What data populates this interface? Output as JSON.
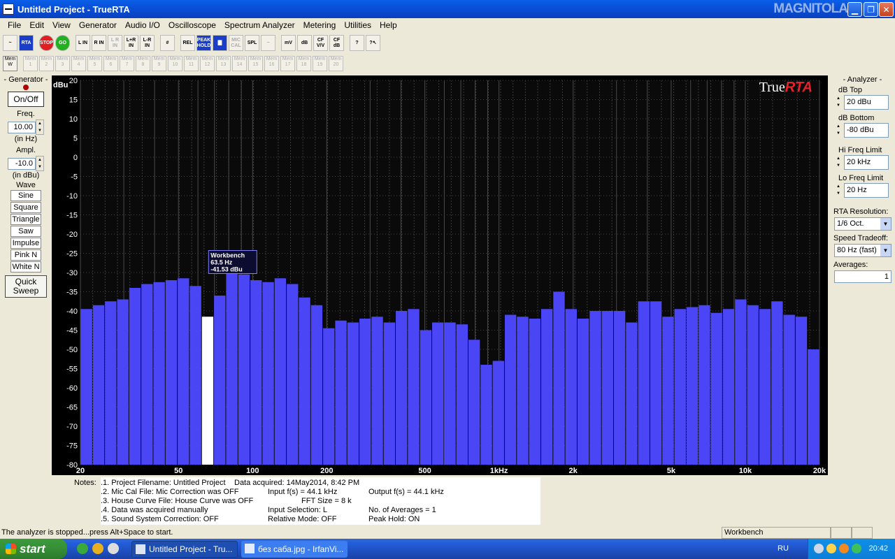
{
  "window": {
    "title": "Untitled Project - TrueRTA",
    "watermark": "MAGNITOLA"
  },
  "menu": [
    "File",
    "Edit",
    "View",
    "Generator",
    "Audio I/O",
    "Oscilloscope",
    "Spectrum Analyzer",
    "Metering",
    "Utilities",
    "Help"
  ],
  "toolbar": {
    "buttons": [
      {
        "name": "oscilloscope-view",
        "label": "~"
      },
      {
        "name": "spectrum-view",
        "label": "RTA"
      },
      {
        "name": "stop",
        "label": "STOP"
      },
      {
        "name": "go",
        "label": "GO"
      },
      {
        "name": "l-in",
        "label": "L IN"
      },
      {
        "name": "r-in",
        "label": "R IN"
      },
      {
        "name": "l-r-in-gray",
        "label": "L R IN"
      },
      {
        "name": "l-plus-r-in",
        "label": "L+R IN"
      },
      {
        "name": "l-minus-r-in",
        "label": "L-R IN"
      },
      {
        "name": "grid",
        "label": "#"
      },
      {
        "name": "rel",
        "label": "REL"
      },
      {
        "name": "peak-hold",
        "label": "PEAK HOLD"
      },
      {
        "name": "bars",
        "label": "▇"
      },
      {
        "name": "mic-cal",
        "label": "MIC CAL"
      },
      {
        "name": "spl",
        "label": "SPL"
      },
      {
        "name": "smooth",
        "label": "~"
      },
      {
        "name": "mv",
        "label": "mV"
      },
      {
        "name": "db",
        "label": "dB"
      },
      {
        "name": "cf-vv",
        "label": "CF V/V"
      },
      {
        "name": "cf-db",
        "label": "CF dB"
      },
      {
        "name": "help",
        "label": "?"
      },
      {
        "name": "context-help",
        "label": "?↖"
      }
    ],
    "mem_buttons": [
      "Mem W",
      "Mem 1",
      "Mem 2",
      "Mem 3",
      "Mem 4",
      "Mem 5",
      "Mem 6",
      "Mem 7",
      "Mem 8",
      "Mem 9",
      "Mem 10",
      "Mem 11",
      "Mem 12",
      "Mem 13",
      "Mem 14",
      "Mem 15",
      "Mem 16",
      "Mem 17",
      "Mem 18",
      "Mem 19",
      "Mem 20"
    ]
  },
  "generator": {
    "title": "- Generator -",
    "onoff_label": "On/Off",
    "freq_label": "Freq.",
    "freq_value": "10.00",
    "freq_unit": "(in Hz)",
    "ampl_label": "Ampl.",
    "ampl_value": "-10.0",
    "ampl_unit": "(in dBu)",
    "wave_label": "Wave",
    "waves": [
      "Sine",
      "Square",
      "Triangle",
      "Saw",
      "Impulse",
      "Pink N",
      "White N"
    ],
    "quick_sweep_label": "Quick Sweep"
  },
  "analyzer": {
    "title": "- Analyzer -",
    "db_top_label": "dB Top",
    "db_top_value": "20 dBu",
    "db_bottom_label": "dB Bottom",
    "db_bottom_value": "-80 dBu",
    "hi_freq_label": "Hi Freq Limit",
    "hi_freq_value": "20 kHz",
    "lo_freq_label": "Lo Freq Limit",
    "lo_freq_value": "20 Hz",
    "rta_res_label": "RTA Resolution:",
    "rta_res_value": "1/6 Oct.",
    "speed_label": "Speed Tradeoff:",
    "speed_value": "80 Hz (fast)",
    "averages_label": "Averages:",
    "averages_value": "1"
  },
  "chart_data": {
    "type": "bar",
    "logo": {
      "a": "True",
      "b": "RTA"
    },
    "ylabel": "dBu",
    "ylim": [
      -80,
      20
    ],
    "yticks": [
      20,
      15,
      10,
      5,
      0,
      -5,
      -10,
      -15,
      -20,
      -25,
      -30,
      -35,
      -40,
      -45,
      -50,
      -55,
      -60,
      -65,
      -70,
      -75,
      -80
    ],
    "xlim": [
      20,
      20000
    ],
    "xscale": "log",
    "xticks": [
      {
        "v": 20,
        "label": "20"
      },
      {
        "v": 50,
        "label": "50"
      },
      {
        "v": 100,
        "label": "100"
      },
      {
        "v": 200,
        "label": "200"
      },
      {
        "v": 500,
        "label": "500"
      },
      {
        "v": 1000,
        "label": "1kHz"
      },
      {
        "v": 2000,
        "label": "2k"
      },
      {
        "v": 5000,
        "label": "5k"
      },
      {
        "v": 10000,
        "label": "10k"
      },
      {
        "v": 20000,
        "label": "20k"
      }
    ],
    "bar_color": "#4a46f5",
    "highlight_color": "#ffffff",
    "values": [
      -39.5,
      -38.5,
      -37.5,
      -37.0,
      -34.0,
      -33.0,
      -32.5,
      -32.0,
      -31.5,
      -33.5,
      -41.5,
      -36.0,
      -29.5,
      -30.5,
      -32.0,
      -32.5,
      -31.5,
      -33.0,
      -36.5,
      -38.5,
      -44.5,
      -42.5,
      -43.0,
      -42.0,
      -41.5,
      -43.0,
      -40.0,
      -39.5,
      -45.0,
      -43.0,
      -43.0,
      -43.5,
      -47.5,
      -54.0,
      -53.0,
      -41.0,
      -41.5,
      -42.0,
      -39.5,
      -35.0,
      -39.5,
      -42.0,
      -40.0,
      -40.0,
      -40.0,
      -43.0,
      -37.5,
      -37.5,
      -41.5,
      -39.5,
      -39.0,
      -38.5,
      -40.5,
      -39.5,
      -37.0,
      -38.5,
      -39.5,
      -37.5,
      -41.0,
      -41.5,
      -50.0
    ],
    "highlight_index": 10,
    "tooltip": {
      "name": "Workbench",
      "freq": "63.5 Hz",
      "level": "-41.53 dBu"
    }
  },
  "notes": {
    "label": "Notes:",
    "lines": [
      ".1. Project Filename: Untitled Project",
      ".2. Mic Cal File: Mic Correction was OFF",
      ".3. House Curve File: House Curve was OFF",
      ".4. Data was acquired manually",
      ".5. Sound System Correction: OFF"
    ],
    "col2": [
      "Data acquired: 14May2014, 8:42 PM",
      "Input f(s) = 44.1 kHz",
      "FFT Size = 8 k",
      "Input Selection: L",
      "Relative Mode:  OFF"
    ],
    "col3": [
      "Output f(s) = 44.1 kHz",
      "No. of Averages = 1",
      "Peak Hold: ON"
    ]
  },
  "status": {
    "text": "The analyzer is stopped...press Alt+Space to start.",
    "panel": "Workbench"
  },
  "taskbar": {
    "start_label": "start",
    "task1": "Untitled Project - Tru...",
    "task2": "без саба.jpg - IrfanVi...",
    "lang": "RU",
    "clock": "20:42"
  }
}
